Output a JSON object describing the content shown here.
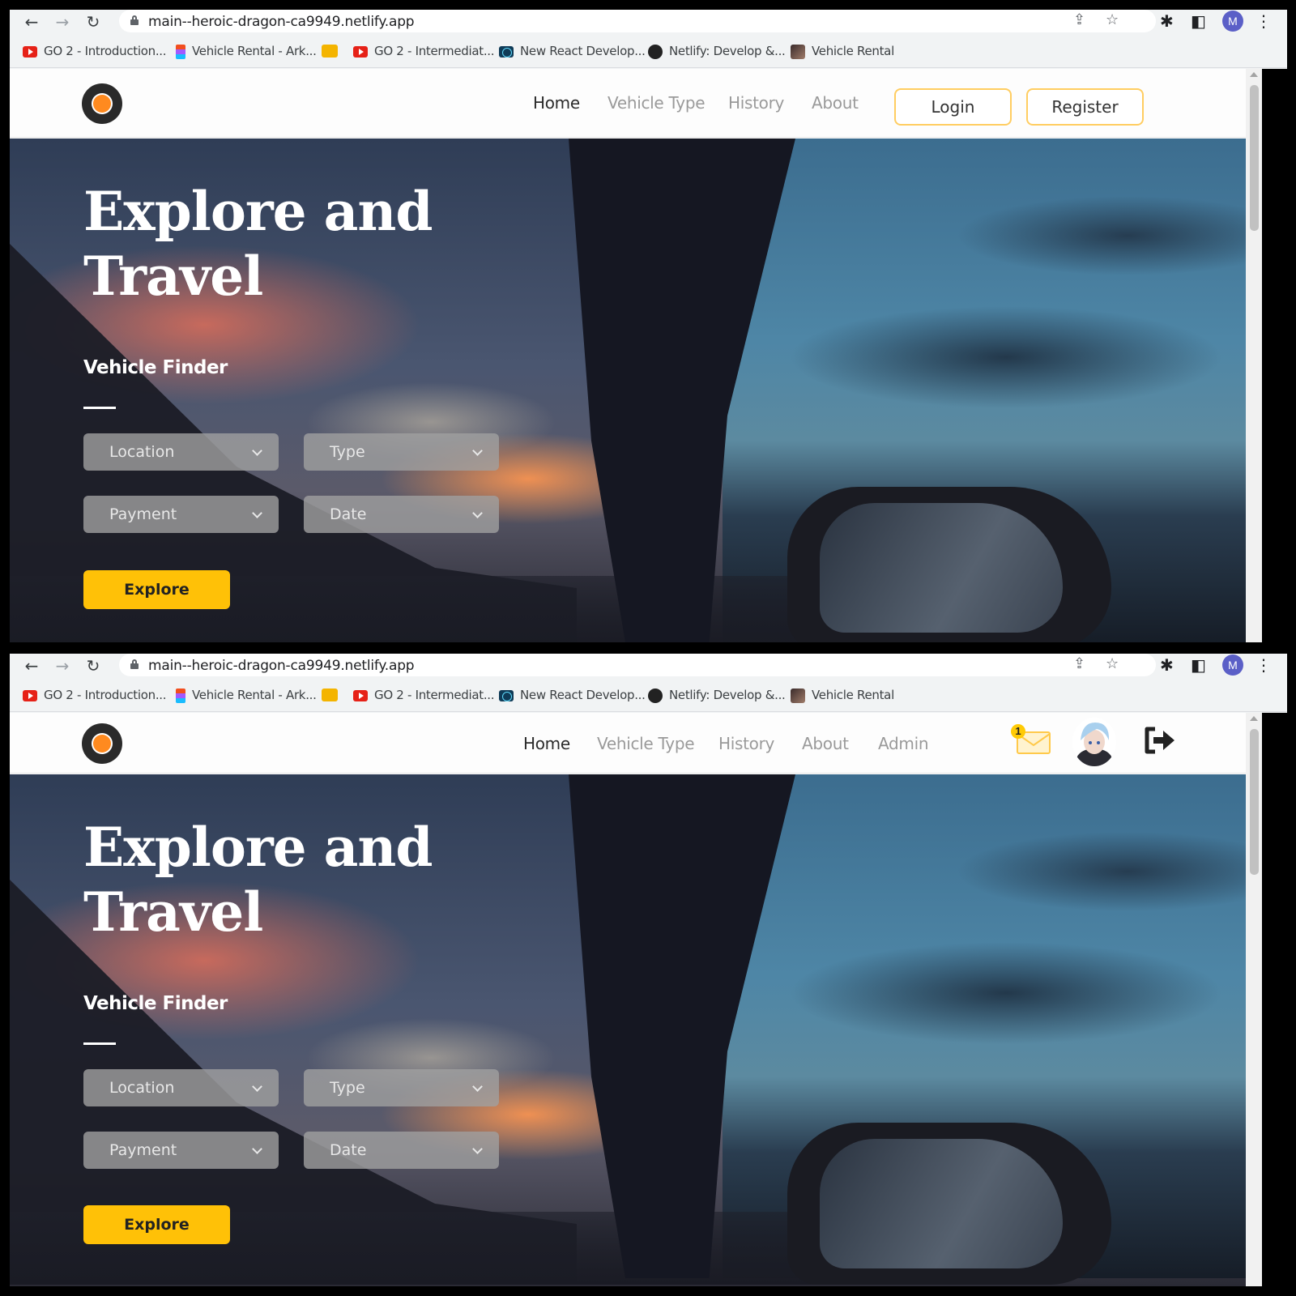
{
  "browser": {
    "url": "main--heroic-dragon-ca9949.netlify.app",
    "profile_initial": "M",
    "bookmarks": [
      {
        "label": "GO 2 - Introduction...",
        "icon": "youtube-icon"
      },
      {
        "label": "Vehicle Rental - Ark...",
        "icon": "figma-icon"
      },
      {
        "label": "",
        "icon": "slides-icon"
      },
      {
        "label": "GO 2 - Intermediat...",
        "icon": "youtube-icon"
      },
      {
        "label": "New React Develop...",
        "icon": "react-icon"
      },
      {
        "label": "Netlify: Develop &...",
        "icon": "netlify-icon"
      },
      {
        "label": "Vehicle Rental",
        "icon": "site-icon"
      }
    ]
  },
  "nav_guest": {
    "links": [
      "Home",
      "Vehicle Type",
      "History",
      "About"
    ],
    "login": "Login",
    "register": "Register"
  },
  "nav_user": {
    "links": [
      "Home",
      "Vehicle Type",
      "History",
      "About",
      "Admin"
    ],
    "message_count": "1"
  },
  "hero": {
    "title_line1": "Explore and",
    "title_line2": "Travel",
    "subtitle": "Vehicle Finder",
    "filters": [
      "Location",
      "Type",
      "Payment",
      "Date"
    ],
    "button": "Explore"
  },
  "colors": {
    "accent": "#ffc107",
    "outline": "#ffcd61",
    "logo_dot": "#ff8a1f"
  }
}
